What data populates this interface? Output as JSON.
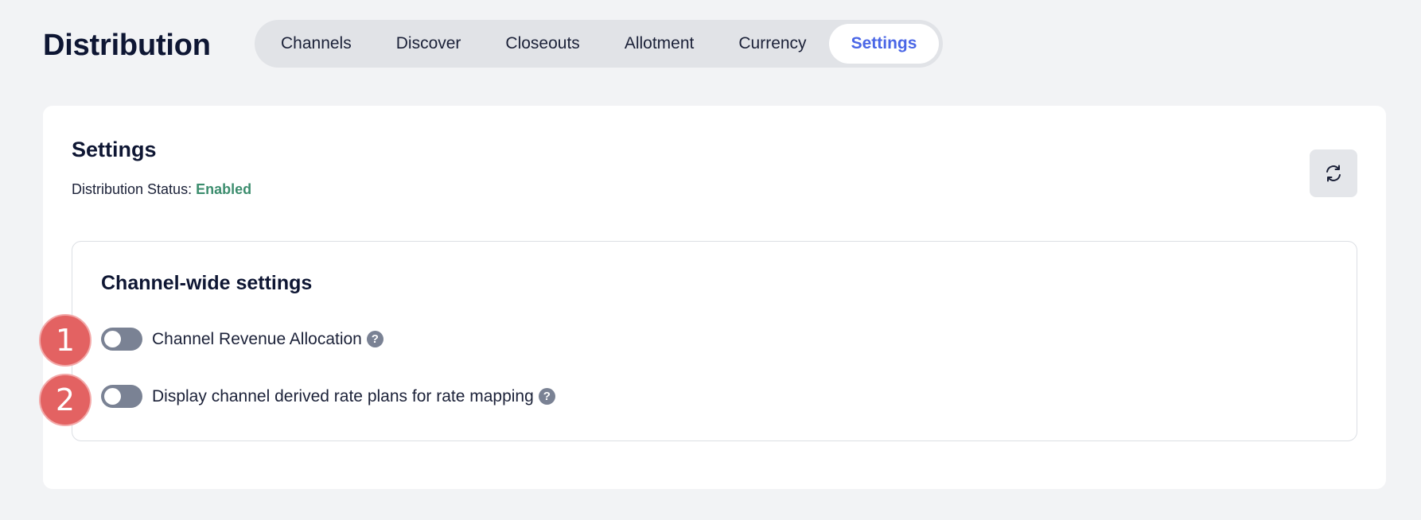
{
  "header": {
    "title": "Distribution",
    "tabs": [
      {
        "label": "Channels",
        "active": false
      },
      {
        "label": "Discover",
        "active": false
      },
      {
        "label": "Closeouts",
        "active": false
      },
      {
        "label": "Allotment",
        "active": false
      },
      {
        "label": "Currency",
        "active": false
      },
      {
        "label": "Settings",
        "active": true
      }
    ]
  },
  "settings": {
    "title": "Settings",
    "status_label": "Distribution Status:",
    "status_value": "Enabled",
    "refresh_icon": "refresh-icon",
    "channel_wide": {
      "title": "Channel-wide settings",
      "items": [
        {
          "label": "Channel Revenue Allocation",
          "enabled": false,
          "marker": "1"
        },
        {
          "label": "Display channel derived rate plans for rate mapping",
          "enabled": false,
          "marker": "2"
        }
      ]
    }
  },
  "colors": {
    "accent": "#4a66e6",
    "status_enabled": "#3c8d6e",
    "toggle_off": "#7a8294",
    "marker": "#e36262"
  }
}
